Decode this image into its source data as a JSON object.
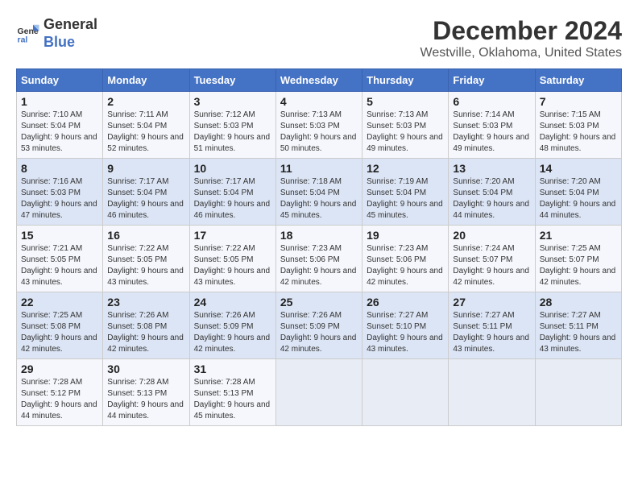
{
  "logo": {
    "line1": "General",
    "line2": "Blue"
  },
  "title": "December 2024",
  "subtitle": "Westville, Oklahoma, United States",
  "days_of_week": [
    "Sunday",
    "Monday",
    "Tuesday",
    "Wednesday",
    "Thursday",
    "Friday",
    "Saturday"
  ],
  "weeks": [
    [
      {
        "num": "1",
        "sunrise": "Sunrise: 7:10 AM",
        "sunset": "Sunset: 5:04 PM",
        "daylight": "Daylight: 9 hours and 53 minutes."
      },
      {
        "num": "2",
        "sunrise": "Sunrise: 7:11 AM",
        "sunset": "Sunset: 5:04 PM",
        "daylight": "Daylight: 9 hours and 52 minutes."
      },
      {
        "num": "3",
        "sunrise": "Sunrise: 7:12 AM",
        "sunset": "Sunset: 5:03 PM",
        "daylight": "Daylight: 9 hours and 51 minutes."
      },
      {
        "num": "4",
        "sunrise": "Sunrise: 7:13 AM",
        "sunset": "Sunset: 5:03 PM",
        "daylight": "Daylight: 9 hours and 50 minutes."
      },
      {
        "num": "5",
        "sunrise": "Sunrise: 7:13 AM",
        "sunset": "Sunset: 5:03 PM",
        "daylight": "Daylight: 9 hours and 49 minutes."
      },
      {
        "num": "6",
        "sunrise": "Sunrise: 7:14 AM",
        "sunset": "Sunset: 5:03 PM",
        "daylight": "Daylight: 9 hours and 49 minutes."
      },
      {
        "num": "7",
        "sunrise": "Sunrise: 7:15 AM",
        "sunset": "Sunset: 5:03 PM",
        "daylight": "Daylight: 9 hours and 48 minutes."
      }
    ],
    [
      {
        "num": "8",
        "sunrise": "Sunrise: 7:16 AM",
        "sunset": "Sunset: 5:03 PM",
        "daylight": "Daylight: 9 hours and 47 minutes."
      },
      {
        "num": "9",
        "sunrise": "Sunrise: 7:17 AM",
        "sunset": "Sunset: 5:04 PM",
        "daylight": "Daylight: 9 hours and 46 minutes."
      },
      {
        "num": "10",
        "sunrise": "Sunrise: 7:17 AM",
        "sunset": "Sunset: 5:04 PM",
        "daylight": "Daylight: 9 hours and 46 minutes."
      },
      {
        "num": "11",
        "sunrise": "Sunrise: 7:18 AM",
        "sunset": "Sunset: 5:04 PM",
        "daylight": "Daylight: 9 hours and 45 minutes."
      },
      {
        "num": "12",
        "sunrise": "Sunrise: 7:19 AM",
        "sunset": "Sunset: 5:04 PM",
        "daylight": "Daylight: 9 hours and 45 minutes."
      },
      {
        "num": "13",
        "sunrise": "Sunrise: 7:20 AM",
        "sunset": "Sunset: 5:04 PM",
        "daylight": "Daylight: 9 hours and 44 minutes."
      },
      {
        "num": "14",
        "sunrise": "Sunrise: 7:20 AM",
        "sunset": "Sunset: 5:04 PM",
        "daylight": "Daylight: 9 hours and 44 minutes."
      }
    ],
    [
      {
        "num": "15",
        "sunrise": "Sunrise: 7:21 AM",
        "sunset": "Sunset: 5:05 PM",
        "daylight": "Daylight: 9 hours and 43 minutes."
      },
      {
        "num": "16",
        "sunrise": "Sunrise: 7:22 AM",
        "sunset": "Sunset: 5:05 PM",
        "daylight": "Daylight: 9 hours and 43 minutes."
      },
      {
        "num": "17",
        "sunrise": "Sunrise: 7:22 AM",
        "sunset": "Sunset: 5:05 PM",
        "daylight": "Daylight: 9 hours and 43 minutes."
      },
      {
        "num": "18",
        "sunrise": "Sunrise: 7:23 AM",
        "sunset": "Sunset: 5:06 PM",
        "daylight": "Daylight: 9 hours and 42 minutes."
      },
      {
        "num": "19",
        "sunrise": "Sunrise: 7:23 AM",
        "sunset": "Sunset: 5:06 PM",
        "daylight": "Daylight: 9 hours and 42 minutes."
      },
      {
        "num": "20",
        "sunrise": "Sunrise: 7:24 AM",
        "sunset": "Sunset: 5:07 PM",
        "daylight": "Daylight: 9 hours and 42 minutes."
      },
      {
        "num": "21",
        "sunrise": "Sunrise: 7:25 AM",
        "sunset": "Sunset: 5:07 PM",
        "daylight": "Daylight: 9 hours and 42 minutes."
      }
    ],
    [
      {
        "num": "22",
        "sunrise": "Sunrise: 7:25 AM",
        "sunset": "Sunset: 5:08 PM",
        "daylight": "Daylight: 9 hours and 42 minutes."
      },
      {
        "num": "23",
        "sunrise": "Sunrise: 7:26 AM",
        "sunset": "Sunset: 5:08 PM",
        "daylight": "Daylight: 9 hours and 42 minutes."
      },
      {
        "num": "24",
        "sunrise": "Sunrise: 7:26 AM",
        "sunset": "Sunset: 5:09 PM",
        "daylight": "Daylight: 9 hours and 42 minutes."
      },
      {
        "num": "25",
        "sunrise": "Sunrise: 7:26 AM",
        "sunset": "Sunset: 5:09 PM",
        "daylight": "Daylight: 9 hours and 42 minutes."
      },
      {
        "num": "26",
        "sunrise": "Sunrise: 7:27 AM",
        "sunset": "Sunset: 5:10 PM",
        "daylight": "Daylight: 9 hours and 43 minutes."
      },
      {
        "num": "27",
        "sunrise": "Sunrise: 7:27 AM",
        "sunset": "Sunset: 5:11 PM",
        "daylight": "Daylight: 9 hours and 43 minutes."
      },
      {
        "num": "28",
        "sunrise": "Sunrise: 7:27 AM",
        "sunset": "Sunset: 5:11 PM",
        "daylight": "Daylight: 9 hours and 43 minutes."
      }
    ],
    [
      {
        "num": "29",
        "sunrise": "Sunrise: 7:28 AM",
        "sunset": "Sunset: 5:12 PM",
        "daylight": "Daylight: 9 hours and 44 minutes."
      },
      {
        "num": "30",
        "sunrise": "Sunrise: 7:28 AM",
        "sunset": "Sunset: 5:13 PM",
        "daylight": "Daylight: 9 hours and 44 minutes."
      },
      {
        "num": "31",
        "sunrise": "Sunrise: 7:28 AM",
        "sunset": "Sunset: 5:13 PM",
        "daylight": "Daylight: 9 hours and 45 minutes."
      },
      null,
      null,
      null,
      null
    ]
  ]
}
